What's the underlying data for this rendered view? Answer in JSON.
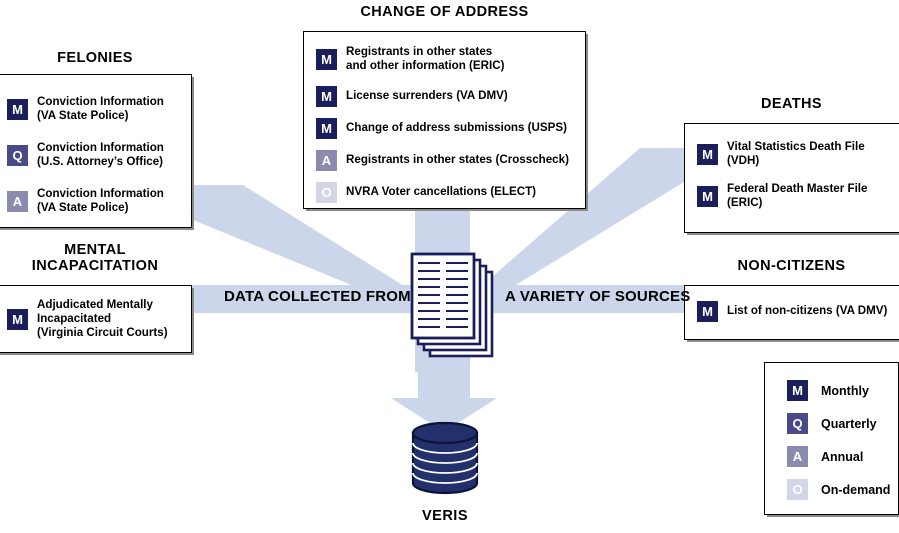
{
  "diagram": {
    "title_center_left": "DATA COLLECTED FROM",
    "title_center_right": "A VARIETY OF SOURCES",
    "target_label": "VERIS",
    "colors": {
      "arrow_band": "#ccd6ea",
      "badge_monthly": "#1a1f5c",
      "badge_quarterly": "#4a4a87",
      "badge_annual": "#8b8bb0",
      "badge_ondemand": "#d2d6e6",
      "document_outline": "#1a1f5c",
      "database_fill": "#22306b",
      "panel_border": "#000000"
    }
  },
  "sections": {
    "felonies": {
      "heading": "FELONIES",
      "items": [
        {
          "badge": "M",
          "text": "Conviction Information\n(VA State Police)"
        },
        {
          "badge": "Q",
          "text": "Conviction Information\n(U.S. Attorney’s Office)"
        },
        {
          "badge": "A",
          "text": "Conviction Information\n(VA State Police)"
        }
      ]
    },
    "change_of_address": {
      "heading": "CHANGE OF ADDRESS",
      "items": [
        {
          "badge": "M",
          "text": "Registrants in other states\nand other information (ERIC)"
        },
        {
          "badge": "M",
          "text": "License surrenders (VA DMV)"
        },
        {
          "badge": "M",
          "text": "Change of address submissions (USPS)"
        },
        {
          "badge": "A",
          "text": "Registrants in other states (Crosscheck)"
        },
        {
          "badge": "O",
          "text": "NVRA Voter cancellations (ELECT)"
        }
      ]
    },
    "deaths": {
      "heading": "DEATHS",
      "items": [
        {
          "badge": "M",
          "text": "Vital Statistics Death File\n(VDH)"
        },
        {
          "badge": "M",
          "text": "Federal Death Master File\n(ERIC)"
        }
      ]
    },
    "mental_incapacitation": {
      "heading": "MENTAL\nINCAPACITATION",
      "items": [
        {
          "badge": "M",
          "text": "Adjudicated Mentally\nIncapacitated\n(Virginia Circuit Courts)"
        }
      ]
    },
    "non_citizens": {
      "heading": "NON-CITIZENS",
      "items": [
        {
          "badge": "M",
          "text": "List of non-citizens (VA DMV)"
        }
      ]
    }
  },
  "legend": {
    "items": [
      {
        "badge": "M",
        "label": "Monthly"
      },
      {
        "badge": "Q",
        "label": "Quarterly"
      },
      {
        "badge": "A",
        "label": "Annual"
      },
      {
        "badge": "O",
        "label": "On-demand"
      }
    ]
  },
  "icons": {
    "documents": "documents-stack-icon",
    "database": "database-cylinder-icon"
  }
}
